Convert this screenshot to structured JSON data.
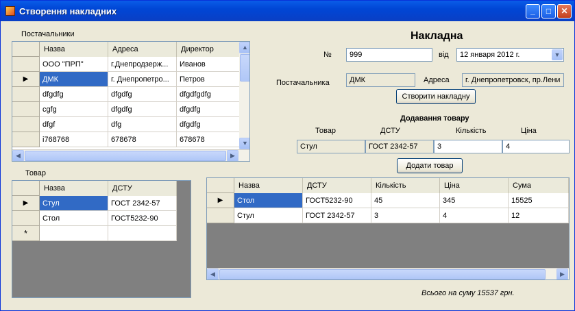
{
  "window": {
    "title": "Створення накладних"
  },
  "suppliers": {
    "label": "Постачальники",
    "columns": [
      "Назва",
      "Адреса",
      "Директор"
    ],
    "rows": [
      [
        "ООО \"ПРП\"",
        "г.Днепродзерж...",
        "Иванов"
      ],
      [
        "ДМК",
        "г. Днепропетро...",
        "Петров"
      ],
      [
        "dfgdfg",
        "dfgdfg",
        "dfgdfgdfg"
      ],
      [
        "cgfg",
        "dfgdfg",
        "dfgdfg"
      ],
      [
        "dfgf",
        "dfg",
        "dfgdfg"
      ],
      [
        "i768768",
        "678678",
        "678678"
      ]
    ]
  },
  "goods": {
    "label": "Товар",
    "columns": [
      "Назва",
      "ДСТУ"
    ],
    "rows": [
      [
        "Стул",
        "ГОСТ 2342-57"
      ],
      [
        "Стол",
        "ГОСТ5232-90"
      ]
    ],
    "new_row_marker": "*"
  },
  "invoice": {
    "heading": "Накладна",
    "number_label": "№",
    "number_value": "999",
    "date_label": "від",
    "date_value": "12  января   2012 г.",
    "supplier_label": "Постачальника",
    "supplier_value": "ДМК",
    "address_label": "Адреса",
    "address_value": "г. Днепропетровск, пр.Лени",
    "create_button": "Створити накладну"
  },
  "add_goods": {
    "heading": "Додавання товару",
    "col_goods": "Товар",
    "col_dstu": "ДСТУ",
    "col_qty": "Кількість",
    "col_price": "Ціна",
    "goods_value": "Стул",
    "dstu_value": "ГОСТ 2342-57",
    "qty_value": "3",
    "price_value": "4",
    "add_button": "Додати товар"
  },
  "items": {
    "columns": [
      "Назва",
      "ДСТУ",
      "Кількість",
      "Ціна",
      "Сума"
    ],
    "rows": [
      [
        "Стол",
        "ГОСТ5232-90",
        "45",
        "345",
        "15525"
      ],
      [
        "Стул",
        "ГОСТ 2342-57",
        "3",
        "4",
        "12"
      ]
    ]
  },
  "total_text": "Всього на суму 15537 грн."
}
